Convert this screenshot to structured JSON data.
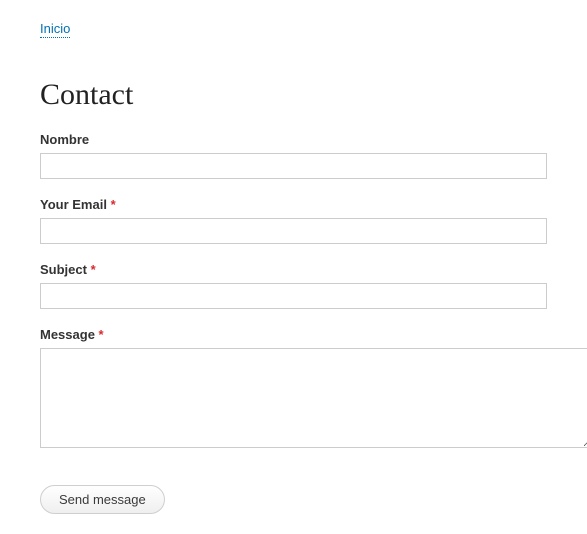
{
  "breadcrumb": {
    "home_label": "Inicio"
  },
  "page": {
    "title": "Contact"
  },
  "form": {
    "fields": {
      "name": {
        "label": "Nombre",
        "required": false,
        "value": ""
      },
      "email": {
        "label": "Your Email ",
        "required": true,
        "value": ""
      },
      "subject": {
        "label": "Subject ",
        "required": true,
        "value": ""
      },
      "message": {
        "label": "Message ",
        "required": true,
        "value": ""
      }
    },
    "required_mark": "*",
    "submit_label": "Send message"
  }
}
